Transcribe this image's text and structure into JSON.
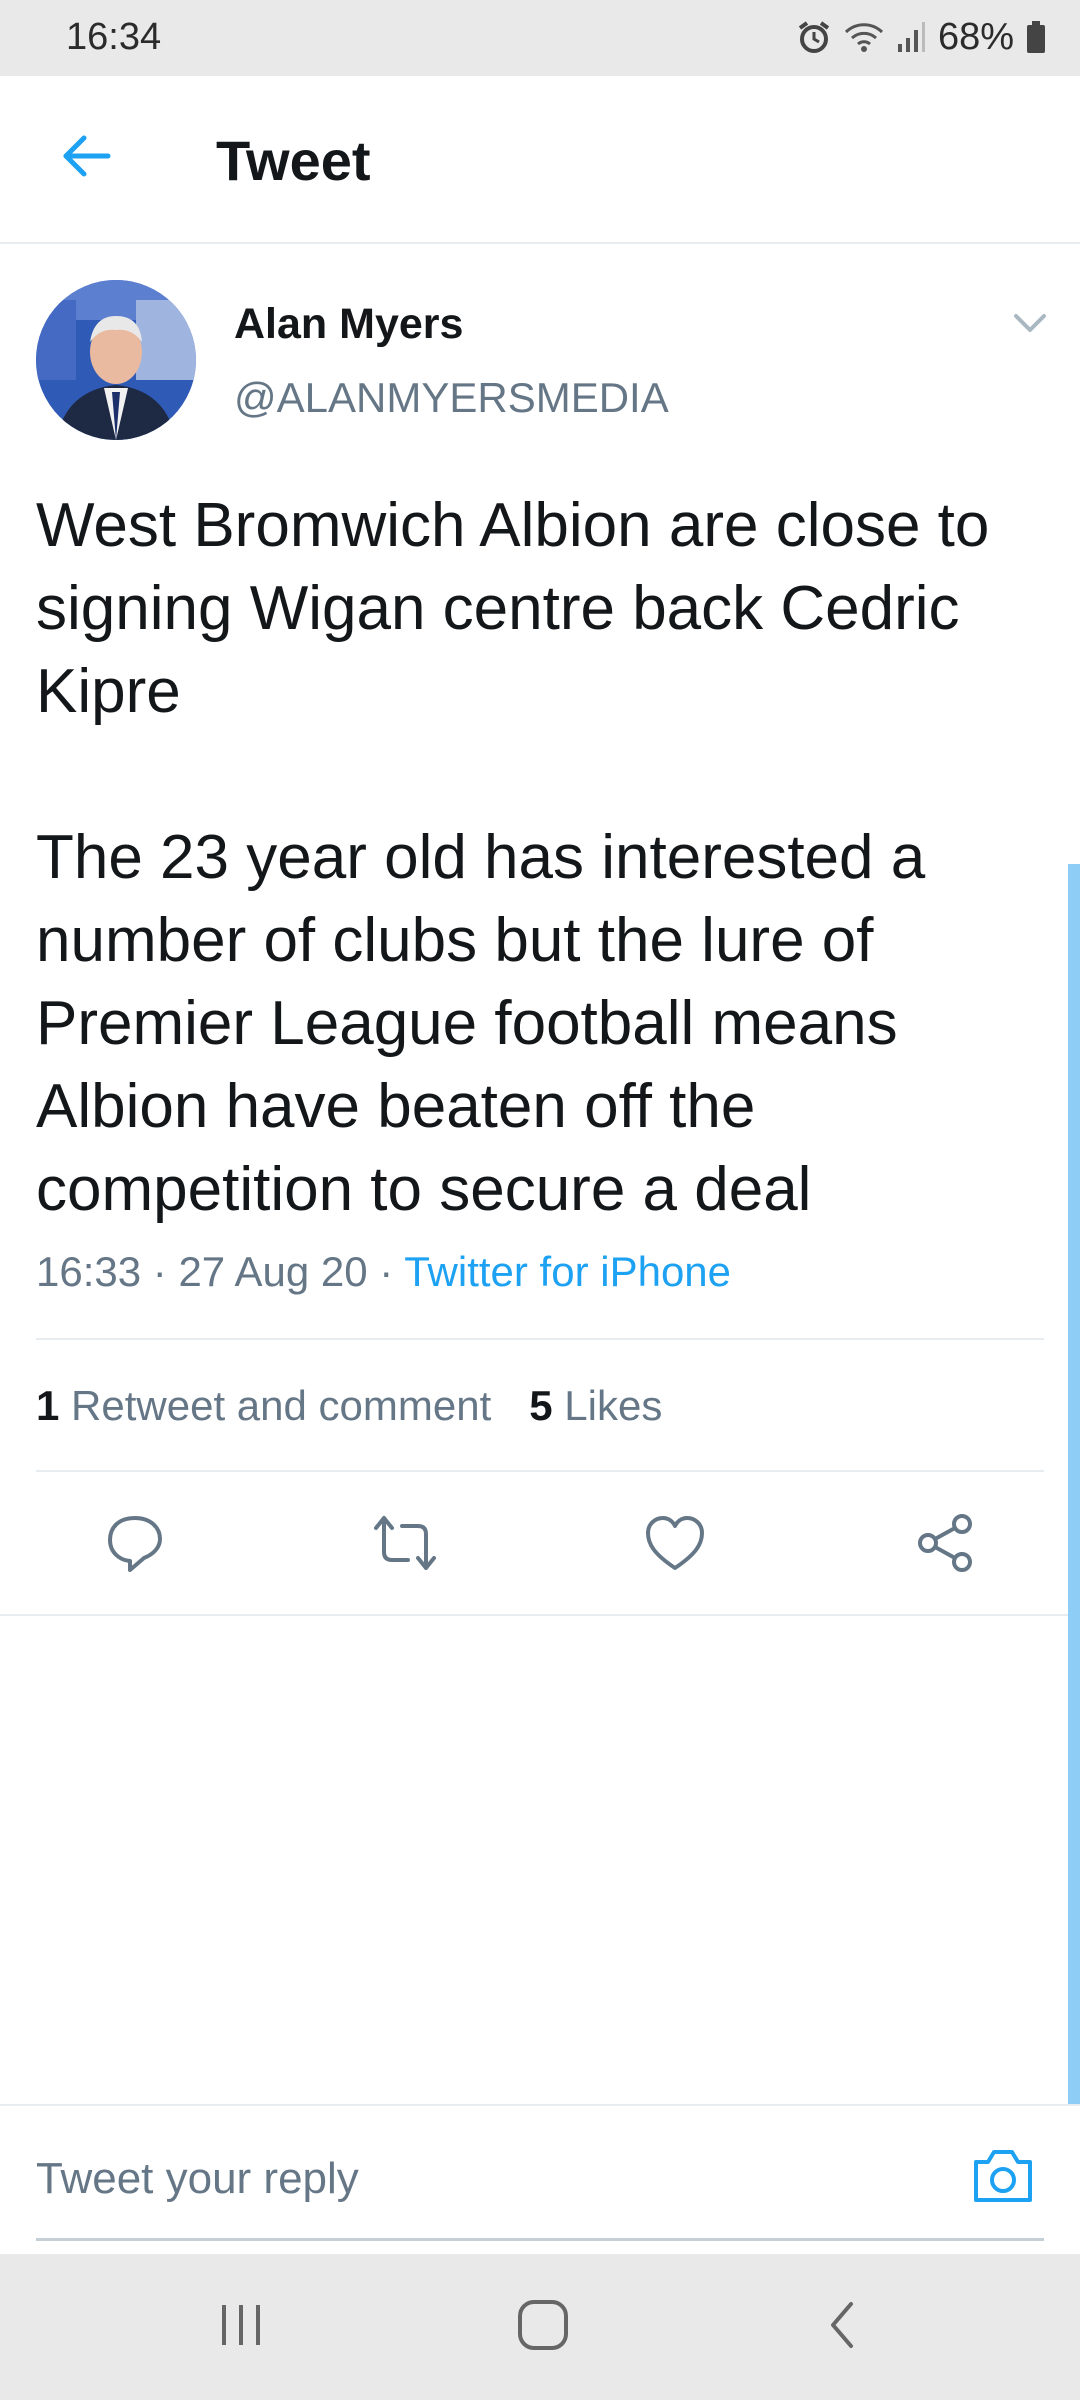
{
  "status_bar": {
    "time": "16:34",
    "battery": "68%",
    "icons": [
      "alarm-icon",
      "wifi-icon",
      "signal-icon",
      "battery-icon"
    ]
  },
  "header": {
    "title": "Tweet",
    "back_icon": "arrow-left-icon"
  },
  "tweet": {
    "author_name": "Alan Myers",
    "author_handle": "@ALANMYERSMEDIA",
    "text": "West Bromwich Albion are close to signing Wigan centre back Cedric Kipre\n\nThe 23 year old has interested a number of clubs but the lure of Premier League football means Albion have beaten off the competition to secure a deal",
    "time": "16:33",
    "date": "27 Aug 20",
    "source": "Twitter for iPhone",
    "retweets_count": "1",
    "retweets_label": "Retweet and comment",
    "likes_count": "5",
    "likes_label": "Likes"
  },
  "actions": [
    "reply-icon",
    "retweet-icon",
    "like-icon",
    "share-icon"
  ],
  "reply": {
    "placeholder": "Tweet your reply",
    "camera_icon": "camera-icon"
  },
  "nav_bar": [
    "recents-icon",
    "home-icon",
    "back-icon"
  ],
  "colors": {
    "accent": "#1da1f2",
    "secondary_text": "#657786",
    "divider": "#e6ecf0"
  }
}
